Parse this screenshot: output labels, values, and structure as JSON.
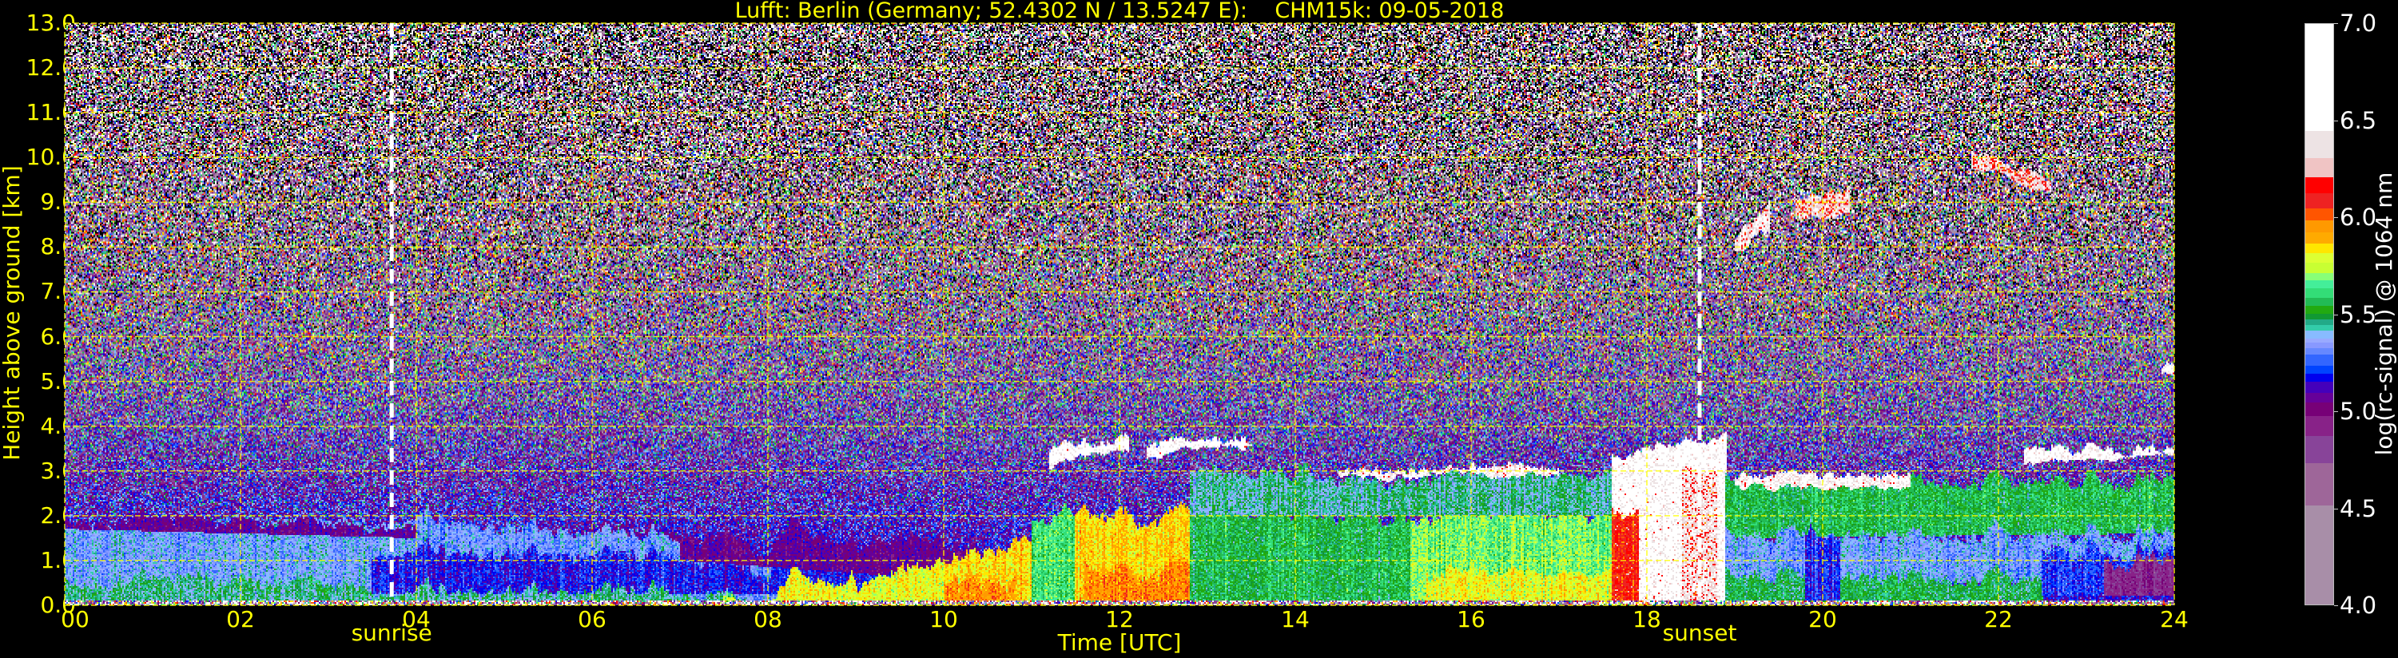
{
  "chart_data": {
    "type": "heatmap",
    "title": "Lufft: Berlin (Germany; 52.4302 N / 13.5247 E):    CHM15k: 09-05-2018",
    "xlabel": "Time [UTC]",
    "ylabel": "Height above ground [km]",
    "xlim": [
      0,
      24
    ],
    "ylim": [
      0,
      13
    ],
    "grid": true,
    "grid_color": "#ffff00",
    "xticks": [
      {
        "value": 0,
        "label": "00"
      },
      {
        "value": 2,
        "label": "02"
      },
      {
        "value": 4,
        "label": "04"
      },
      {
        "value": 6,
        "label": "06"
      },
      {
        "value": 8,
        "label": "08"
      },
      {
        "value": 10,
        "label": "10"
      },
      {
        "value": 12,
        "label": "12"
      },
      {
        "value": 14,
        "label": "14"
      },
      {
        "value": 16,
        "label": "16"
      },
      {
        "value": 18,
        "label": "18"
      },
      {
        "value": 20,
        "label": "20"
      },
      {
        "value": 22,
        "label": "22"
      },
      {
        "value": 24,
        "label": "24"
      }
    ],
    "yticks": [
      {
        "value": 0,
        "label": "0.0"
      },
      {
        "value": 1,
        "label": "1.0"
      },
      {
        "value": 2,
        "label": "2.0"
      },
      {
        "value": 3,
        "label": "3.0"
      },
      {
        "value": 4,
        "label": "4.0"
      },
      {
        "value": 5,
        "label": "5.0"
      },
      {
        "value": 6,
        "label": "6.0"
      },
      {
        "value": 7,
        "label": "7.0"
      },
      {
        "value": 8,
        "label": "8.0"
      },
      {
        "value": 9,
        "label": "9.0"
      },
      {
        "value": 10,
        "label": "10.0"
      },
      {
        "value": 11,
        "label": "11.0"
      },
      {
        "value": 12,
        "label": "12.0"
      },
      {
        "value": 13,
        "label": "13.0"
      }
    ],
    "markers": [
      {
        "label": "sunrise",
        "time": 3.72,
        "color": "#ffffff"
      },
      {
        "label": "sunset",
        "time": 18.6,
        "color": "#ffffff"
      }
    ],
    "colorbar": {
      "label": "log(rc-signal) @ 1064 nm",
      "range": [
        4.0,
        7.0
      ],
      "ticks": [
        {
          "value": 4.0,
          "label": "4.0"
        },
        {
          "value": 4.5,
          "label": "4.5"
        },
        {
          "value": 5.0,
          "label": "5.0"
        },
        {
          "value": 5.5,
          "label": "5.5"
        },
        {
          "value": 6.0,
          "label": "6.0"
        },
        {
          "value": 6.5,
          "label": "6.5"
        },
        {
          "value": 7.0,
          "label": "7.0"
        }
      ],
      "levels": [
        {
          "from": 4.0,
          "to": 4.52,
          "color": "#a88ea8"
        },
        {
          "from": 4.52,
          "to": 4.74,
          "color": "#9e6699"
        },
        {
          "from": 4.74,
          "to": 4.88,
          "color": "#884499"
        },
        {
          "from": 4.88,
          "to": 4.98,
          "color": "#882288"
        },
        {
          "from": 4.98,
          "to": 5.05,
          "color": "#770077"
        },
        {
          "from": 5.05,
          "to": 5.1,
          "color": "#660099"
        },
        {
          "from": 5.1,
          "to": 5.16,
          "color": "#4400bb"
        },
        {
          "from": 5.16,
          "to": 5.2,
          "color": "#0000ee"
        },
        {
          "from": 5.2,
          "to": 5.24,
          "color": "#0044ff"
        },
        {
          "from": 5.24,
          "to": 5.3,
          "color": "#3366ff"
        },
        {
          "from": 5.3,
          "to": 5.33,
          "color": "#6688ff"
        },
        {
          "from": 5.33,
          "to": 5.36,
          "color": "#8899ff"
        },
        {
          "from": 5.36,
          "to": 5.38,
          "color": "#99aaff"
        },
        {
          "from": 5.38,
          "to": 5.42,
          "color": "#88bbff"
        },
        {
          "from": 5.42,
          "to": 5.45,
          "color": "#33ccaa"
        },
        {
          "from": 5.45,
          "to": 5.48,
          "color": "#22aa88"
        },
        {
          "from": 5.48,
          "to": 5.51,
          "color": "#119933"
        },
        {
          "from": 5.51,
          "to": 5.55,
          "color": "#22aa11"
        },
        {
          "from": 5.55,
          "to": 5.59,
          "color": "#22bb55"
        },
        {
          "from": 5.59,
          "to": 5.64,
          "color": "#33dd77"
        },
        {
          "from": 5.64,
          "to": 5.68,
          "color": "#44ee99"
        },
        {
          "from": 5.68,
          "to": 5.72,
          "color": "#88ff77"
        },
        {
          "from": 5.72,
          "to": 5.77,
          "color": "#c8ff33"
        },
        {
          "from": 5.77,
          "to": 5.82,
          "color": "#ddff33"
        },
        {
          "from": 5.82,
          "to": 5.87,
          "color": "#ffe600"
        },
        {
          "from": 5.87,
          "to": 5.93,
          "color": "#ffaa00"
        },
        {
          "from": 5.93,
          "to": 5.99,
          "color": "#ff9900"
        },
        {
          "from": 5.99,
          "to": 6.05,
          "color": "#ff5500"
        },
        {
          "from": 6.05,
          "to": 6.13,
          "color": "#ee2222"
        },
        {
          "from": 6.13,
          "to": 6.21,
          "color": "#ff0000"
        },
        {
          "from": 6.21,
          "to": 6.31,
          "color": "#f0c4c4"
        },
        {
          "from": 6.31,
          "to": 6.45,
          "color": "#ede3e4"
        },
        {
          "from": 6.45,
          "to": 7.0,
          "color": "#ffffff"
        }
      ]
    },
    "features": [
      {
        "t": [
          0,
          4
        ],
        "h_start": [
          0,
          2.0
        ],
        "h_end": [
          0,
          1.9
        ],
        "value": 5.36
      },
      {
        "t": [
          0,
          3.5
        ],
        "h_start": [
          0.1,
          0.6
        ],
        "h_end": [
          0.1,
          0.5
        ],
        "value": 5.47
      },
      {
        "t": [
          0,
          8
        ],
        "h_start": [
          1.7,
          2.0
        ],
        "h_end": [
          1.3,
          1.6
        ],
        "value": 5.06
      },
      {
        "t": [
          4,
          8.5
        ],
        "h_start": [
          0,
          1.9
        ],
        "h_end": [
          0,
          1.3
        ],
        "value": 5.34
      },
      {
        "t": [
          3.5,
          9.5
        ],
        "h_start": [
          0.25,
          1.2
        ],
        "h_end": [
          0.25,
          1.0
        ],
        "value": 5.18
      },
      {
        "t": [
          7,
          10.5
        ],
        "h_start": [
          1.0,
          1.6
        ],
        "h_end": [
          0.5,
          1.3
        ],
        "value": 5.06
      },
      {
        "t": [
          0,
          8
        ],
        "h_start": [
          0.1,
          0.3
        ],
        "h_end": [
          0.1,
          0.3
        ],
        "value": 5.45
      },
      {
        "t": [
          7.5,
          10
        ],
        "h_start": [
          0,
          0.2
        ],
        "h_end": [
          0,
          0.8
        ],
        "value": 5.8
      },
      {
        "t": [
          10,
          11
        ],
        "h_start": [
          0,
          1.0
        ],
        "h_end": [
          0,
          1.6
        ],
        "value": 5.85
      },
      {
        "t": [
          10,
          10.8
        ],
        "h_start": [
          0,
          0.6
        ],
        "h_end": [
          0,
          0.6
        ],
        "value": 5.96
      },
      {
        "t": [
          11,
          11.5
        ],
        "h_start": [
          0,
          2.0
        ],
        "h_end": [
          0,
          2.0
        ],
        "value": 5.62
      },
      {
        "t": [
          11.5,
          12.8
        ],
        "h_start": [
          0,
          2.0
        ],
        "h_end": [
          0,
          2.0
        ],
        "value": 5.86
      },
      {
        "t": [
          11.6,
          12.8
        ],
        "h_start": [
          0,
          0.8
        ],
        "h_end": [
          0,
          0.8
        ],
        "value": 5.97
      },
      {
        "t": [
          12.8,
          15.3
        ],
        "h_start": [
          0,
          2.0
        ],
        "h_end": [
          0,
          2.1
        ],
        "value": 5.55
      },
      {
        "t": [
          15.3,
          17.6
        ],
        "h_start": [
          0,
          2.0
        ],
        "h_end": [
          0,
          2.0
        ],
        "value": 5.68
      },
      {
        "t": [
          15.5,
          17.6
        ],
        "h_start": [
          0,
          0.7
        ],
        "h_end": [
          0,
          0.7
        ],
        "value": 5.8
      },
      {
        "t": [
          12.8,
          17.6
        ],
        "h_start": [
          2.0,
          2.9
        ],
        "h_end": [
          2.0,
          2.9
        ],
        "value": 5.45
      },
      {
        "t": [
          17.6,
          18.9
        ],
        "h_start": [
          0,
          3.3
        ],
        "h_end": [
          0,
          3.8
        ],
        "value": 6.6
      },
      {
        "t": [
          17.6,
          17.9
        ],
        "h_start": [
          0,
          2.0
        ],
        "h_end": [
          0,
          2.0
        ],
        "value": 6.1
      },
      {
        "t": [
          18.4,
          18.8
        ],
        "h_start": [
          0,
          3.0
        ],
        "h_end": [
          0,
          3.0
        ],
        "value": 6.35
      },
      {
        "t": [
          18.9,
          24
        ],
        "h_start": [
          1.5,
          2.7
        ],
        "h_end": [
          1.6,
          2.8
        ],
        "value": 5.55
      },
      {
        "t": [
          18.9,
          24
        ],
        "h_start": [
          0.5,
          1.5
        ],
        "h_end": [
          0.5,
          1.6
        ],
        "value": 5.36
      },
      {
        "t": [
          18.9,
          22.5
        ],
        "h_start": [
          0.1,
          0.6
        ],
        "h_end": [
          0.1,
          0.6
        ],
        "value": 5.52
      },
      {
        "t": [
          19.8,
          20.2
        ],
        "h_start": [
          0.1,
          1.5
        ],
        "h_end": [
          0.1,
          1.5
        ],
        "value": 5.2
      },
      {
        "t": [
          22.5,
          24
        ],
        "h_start": [
          0.2,
          1.2
        ],
        "h_end": [
          0.2,
          1.2
        ],
        "value": 5.22
      },
      {
        "t": [
          23.2,
          24
        ],
        "h_start": [
          0.2,
          1.0
        ],
        "h_end": [
          0.2,
          1.0
        ],
        "value": 4.92
      },
      {
        "t": [
          11.2,
          12.1
        ],
        "h_start": [
          3.2,
          3.45
        ],
        "h_end": [
          3.5,
          3.7
        ],
        "value": 6.6
      },
      {
        "t": [
          12.3,
          13.5
        ],
        "h_start": [
          3.4,
          3.6
        ],
        "h_end": [
          3.5,
          3.7
        ],
        "value": 6.6
      },
      {
        "t": [
          14.5,
          17.0
        ],
        "h_start": [
          2.9,
          3.05
        ],
        "h_end": [
          2.9,
          3.05
        ],
        "value": 6.5
      },
      {
        "t": [
          19.0,
          21.0
        ],
        "h_start": [
          2.6,
          2.9
        ],
        "h_end": [
          2.6,
          2.9
        ],
        "value": 6.5
      },
      {
        "t": [
          22.3,
          24
        ],
        "h_start": [
          3.2,
          3.5
        ],
        "h_end": [
          3.3,
          3.5
        ],
        "value": 6.6
      },
      {
        "t": [
          19.0,
          19.4
        ],
        "h_start": [
          7.8,
          8.2
        ],
        "h_end": [
          8.4,
          9.0
        ],
        "value": 6.4
      },
      {
        "t": [
          19.7,
          20.3
        ],
        "h_start": [
          8.6,
          9.0
        ],
        "h_end": [
          8.7,
          9.3
        ],
        "value": 6.3
      },
      {
        "t": [
          21.7,
          22.6
        ],
        "h_start": [
          9.8,
          10.1
        ],
        "h_end": [
          9.2,
          9.5
        ],
        "value": 6.3
      },
      {
        "t": [
          23.85,
          24
        ],
        "h_start": [
          5.1,
          5.4
        ],
        "h_end": [
          5.1,
          5.4
        ],
        "value": 6.6
      }
    ]
  }
}
